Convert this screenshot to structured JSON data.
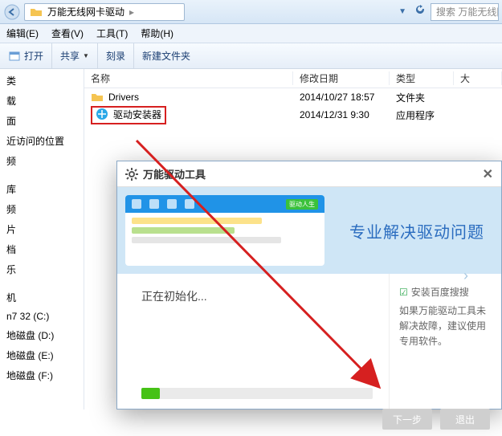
{
  "address_bar": {
    "folder_name": "万能无线网卡驱动",
    "search_placeholder": "搜索 万能无线网"
  },
  "menus": {
    "edit": "编辑(E)",
    "view": "查看(V)",
    "tools": "工具(T)",
    "help": "帮助(H)"
  },
  "toolbar": {
    "open": "打开",
    "share": "共享",
    "burn": "刻录",
    "new_folder": "新建文件夹"
  },
  "nav_items": [
    "类",
    "载",
    "面",
    "近访问的位置",
    "频",
    "库",
    "频",
    "片",
    "档",
    "乐",
    "机",
    "n7 32 (C:)",
    "地磁盘 (D:)",
    "地磁盘 (E:)",
    "地磁盘 (F:)"
  ],
  "columns": {
    "name": "名称",
    "date": "修改日期",
    "type": "类型",
    "size": "大"
  },
  "files": [
    {
      "name": "Drivers",
      "date": "2014/10/27 18:57",
      "type": "文件夹",
      "icon": "folder"
    },
    {
      "name": "驱动安装器",
      "date": "2014/12/31 9:30",
      "type": "应用程序",
      "icon": "app",
      "highlight": true
    }
  ],
  "dialog": {
    "title": "万能驱动工具",
    "banner_badge": "驱动人生",
    "slogan": "专业解决驱动问题",
    "status": "正在初始化...",
    "tip_title": "安装百度搜搜",
    "tip_body": "如果万能驱动工具未解决故障，建议使用专用软件。",
    "btn_primary": "下一步",
    "btn_cancel": "退出",
    "progress_percent": 8
  }
}
